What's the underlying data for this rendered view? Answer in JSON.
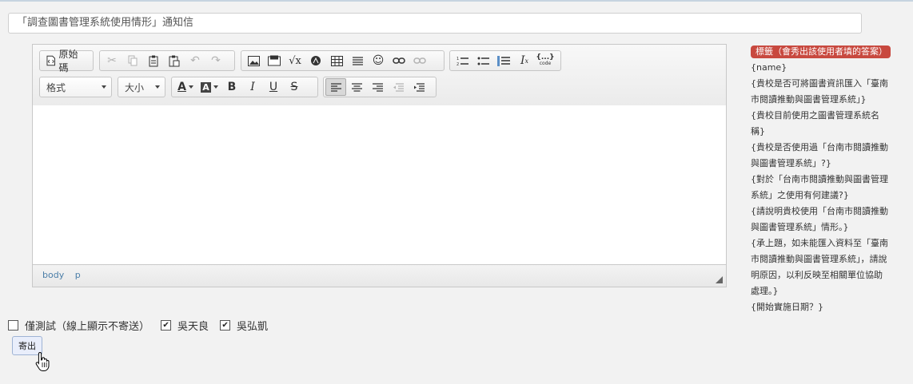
{
  "subject": {
    "value": "「調查圖書管理系統使用情形」通知信"
  },
  "toolbar": {
    "source_label": "原始碼",
    "format_label": "格式",
    "size_label": "大小",
    "icons": [
      "cut-icon",
      "copy-icon",
      "paste-icon",
      "paste-text-icon",
      "undo-icon",
      "redo-icon",
      "image-icon",
      "flash-icon",
      "math-icon",
      "anchor-icon",
      "table-icon",
      "hr-icon",
      "smiley-icon",
      "link-icon",
      "unlink-icon",
      "numbered-list-icon",
      "bulleted-list-icon",
      "blockquote-icon",
      "remove-format-icon",
      "code-snippet-icon",
      "font-color-icon",
      "bg-color-icon",
      "bold-icon",
      "italic-icon",
      "underline-icon",
      "strike-icon",
      "align-left-icon",
      "align-center-icon",
      "align-right-icon",
      "outdent-icon",
      "indent-icon"
    ],
    "code_label": "{...}",
    "code_sub": "code"
  },
  "status_path": [
    "body",
    "p"
  ],
  "tags": {
    "title": "標籤（會秀出該使用者填的答案）",
    "items": [
      "{name}",
      "{貴校是否可將圖書資訊匯入「臺南市閱讀推動與圖書管理系統」}",
      "{貴校目前使用之圖書管理系統名稱}",
      "{貴校是否使用過「台南市閱讀推動與圖書管理系統」?}",
      "{對於「台南市閱讀推動與圖書管理系統」之使用有何建議?}",
      "{請說明貴校使用「台南市閱讀推動與圖書管理系統」情形。}",
      "{承上題，如未能匯入資料至「臺南市閱讀推動與圖書管理系統」，請說明原因，以利反映至相關單位協助處理。}",
      "{開始實施日期？}"
    ]
  },
  "checks": {
    "test_only": {
      "label": "僅測試（線上顯示不寄送）",
      "checked": false
    },
    "user1": {
      "label": "吳天良",
      "checked": true
    },
    "user2": {
      "label": "吳弘凱",
      "checked": true
    }
  },
  "send": {
    "label": "寄出"
  },
  "colors": {
    "tag_title_bg": "#c8493f",
    "link_blue": "#4b7ea8"
  }
}
